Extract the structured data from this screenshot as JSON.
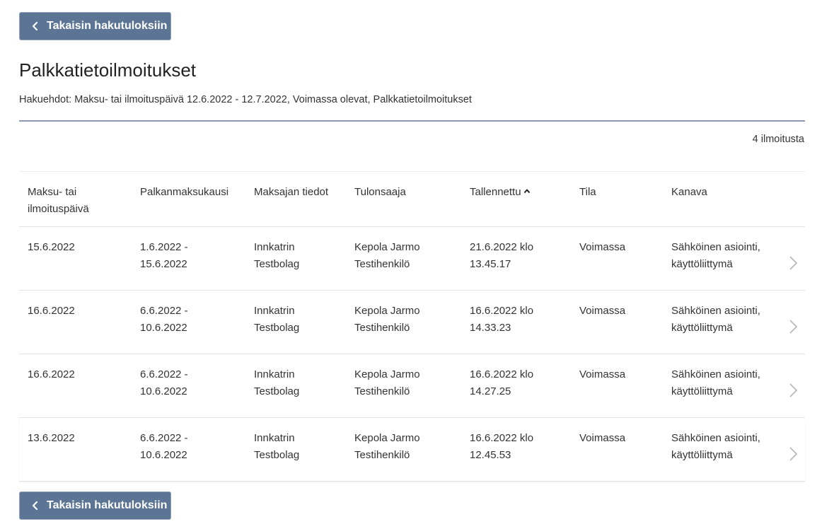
{
  "nav": {
    "back_label": "Takaisin hakutuloksiin"
  },
  "page": {
    "title": "Palkkatietoilmoitukset",
    "criteria": "Hakuehdot: Maksu- tai ilmoituspäivä 12.6.2022 - 12.7.2022, Voimassa olevat, Palkkatietoilmoitukset",
    "count": "4 ilmoitusta"
  },
  "table": {
    "headers": {
      "payment_date_1": "Maksu- tai",
      "payment_date_2": "ilmoituspäivä",
      "pay_period": "Palkanmaksukausi",
      "payer": "Maksajan tiedot",
      "recipient": "Tulonsaaja",
      "saved": "Tallennettu",
      "status": "Tila",
      "channel": "Kanava"
    },
    "rows": [
      {
        "date": "15.6.2022",
        "period_1": "1.6.2022 -",
        "period_2": "15.6.2022",
        "payer_1": "Innkatrin",
        "payer_2": "Testbolag",
        "recipient_1": "Kepola Jarmo",
        "recipient_2": "Testihenkilö",
        "saved_1": "21.6.2022 klo",
        "saved_2": "13.45.17",
        "status": "Voimassa",
        "channel_1": "Sähköinen asiointi,",
        "channel_2": "käyttöliittymä"
      },
      {
        "date": "16.6.2022",
        "period_1": "6.6.2022 -",
        "period_2": "10.6.2022",
        "payer_1": "Innkatrin",
        "payer_2": "Testbolag",
        "recipient_1": "Kepola Jarmo",
        "recipient_2": "Testihenkilö",
        "saved_1": "16.6.2022 klo",
        "saved_2": "14.33.23",
        "status": "Voimassa",
        "channel_1": "Sähköinen asiointi,",
        "channel_2": "käyttöliittymä"
      },
      {
        "date": "16.6.2022",
        "period_1": "6.6.2022 -",
        "period_2": "10.6.2022",
        "payer_1": "Innkatrin",
        "payer_2": "Testbolag",
        "recipient_1": "Kepola Jarmo",
        "recipient_2": "Testihenkilö",
        "saved_1": "16.6.2022 klo",
        "saved_2": "14.27.25",
        "status": "Voimassa",
        "channel_1": "Sähköinen asiointi,",
        "channel_2": "käyttöliittymä"
      },
      {
        "date": "13.6.2022",
        "period_1": "6.6.2022 -",
        "period_2": "10.6.2022",
        "payer_1": "Innkatrin",
        "payer_2": "Testbolag",
        "recipient_1": "Kepola Jarmo",
        "recipient_2": "Testihenkilö",
        "saved_1": "16.6.2022 klo",
        "saved_2": "12.45.53",
        "status": "Voimassa",
        "channel_1": "Sähköinen asiointi,",
        "channel_2": "käyttöliittymä"
      }
    ]
  },
  "icons": {
    "back": "chevron-left-icon",
    "sort": "sort-ascending-icon",
    "row_open": "chevron-right-icon"
  },
  "colors": {
    "button_bg": "#5c7594",
    "divider": "#8a9bb0",
    "row_chevron": "#b5b5b5"
  }
}
